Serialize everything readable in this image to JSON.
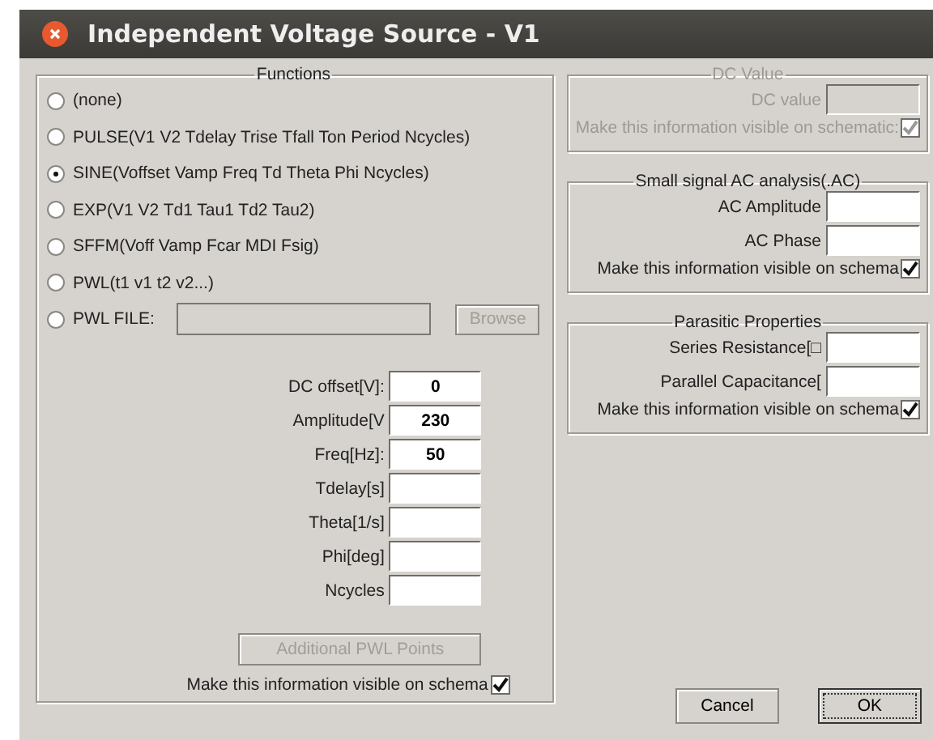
{
  "window": {
    "title": "Independent Voltage Source - V1"
  },
  "functions": {
    "legend": "Functions",
    "options": [
      {
        "kind": "plain",
        "label": "(none)",
        "selected": false
      },
      {
        "kind": "plain",
        "label": "PULSE(V1 V2 Tdelay Trise Tfall Ton Period Ncycles)",
        "selected": false
      },
      {
        "kind": "plain",
        "label": "SINE(Voffset Vamp Freq Td Theta Phi Ncycles)",
        "selected": true
      },
      {
        "kind": "plain",
        "label": "EXP(V1 V2 Td1 Tau1 Td2 Tau2)",
        "selected": false
      },
      {
        "kind": "plain",
        "label": "SFFM(Voff Vamp Fcar MDI Fsig)",
        "selected": false
      },
      {
        "kind": "plain",
        "label": "PWL(t1 v1 t2 v2...)",
        "selected": false
      },
      {
        "kind": "file",
        "label": "PWL FILE:",
        "selected": false,
        "button": "Browse",
        "disabled": true
      }
    ],
    "params": [
      {
        "label": "DC offset[V]:",
        "value": "0"
      },
      {
        "label": "Amplitude[V",
        "value": "230"
      },
      {
        "label": "Freq[Hz]:",
        "value": "50"
      },
      {
        "label": "Tdelay[s]"
      },
      {
        "label": "Theta[1/s]"
      },
      {
        "label": "Phi[deg]"
      },
      {
        "label": "Ncycles"
      }
    ],
    "additional_button": {
      "label": "Additional PWL Points",
      "disabled": true
    },
    "visible": {
      "label": "Make this information visible on schema",
      "checked": true
    }
  },
  "dc_value": {
    "legend": "DC Value",
    "disabled": true,
    "fields": [
      {
        "label": "DC value"
      }
    ],
    "visible": {
      "label": "Make this information visible on schematic:",
      "checked": true
    }
  },
  "ac_analysis": {
    "legend": "Small signal AC analysis(.AC)",
    "disabled": false,
    "fields": [
      {
        "label": "AC Amplitude"
      },
      {
        "label": "AC Phase"
      }
    ],
    "visible": {
      "label": "Make this information visible on schema",
      "checked": true
    }
  },
  "parasitic": {
    "legend": "Parasitic Properties",
    "disabled": false,
    "fields": [
      {
        "label": "Series Resistance[□"
      },
      {
        "label": "Parallel Capacitance["
      }
    ],
    "visible": {
      "label": "Make this information visible on schema",
      "checked": true
    }
  },
  "buttons": [
    {
      "label": "Cancel",
      "default": false
    },
    {
      "label": "OK",
      "default": true
    }
  ]
}
